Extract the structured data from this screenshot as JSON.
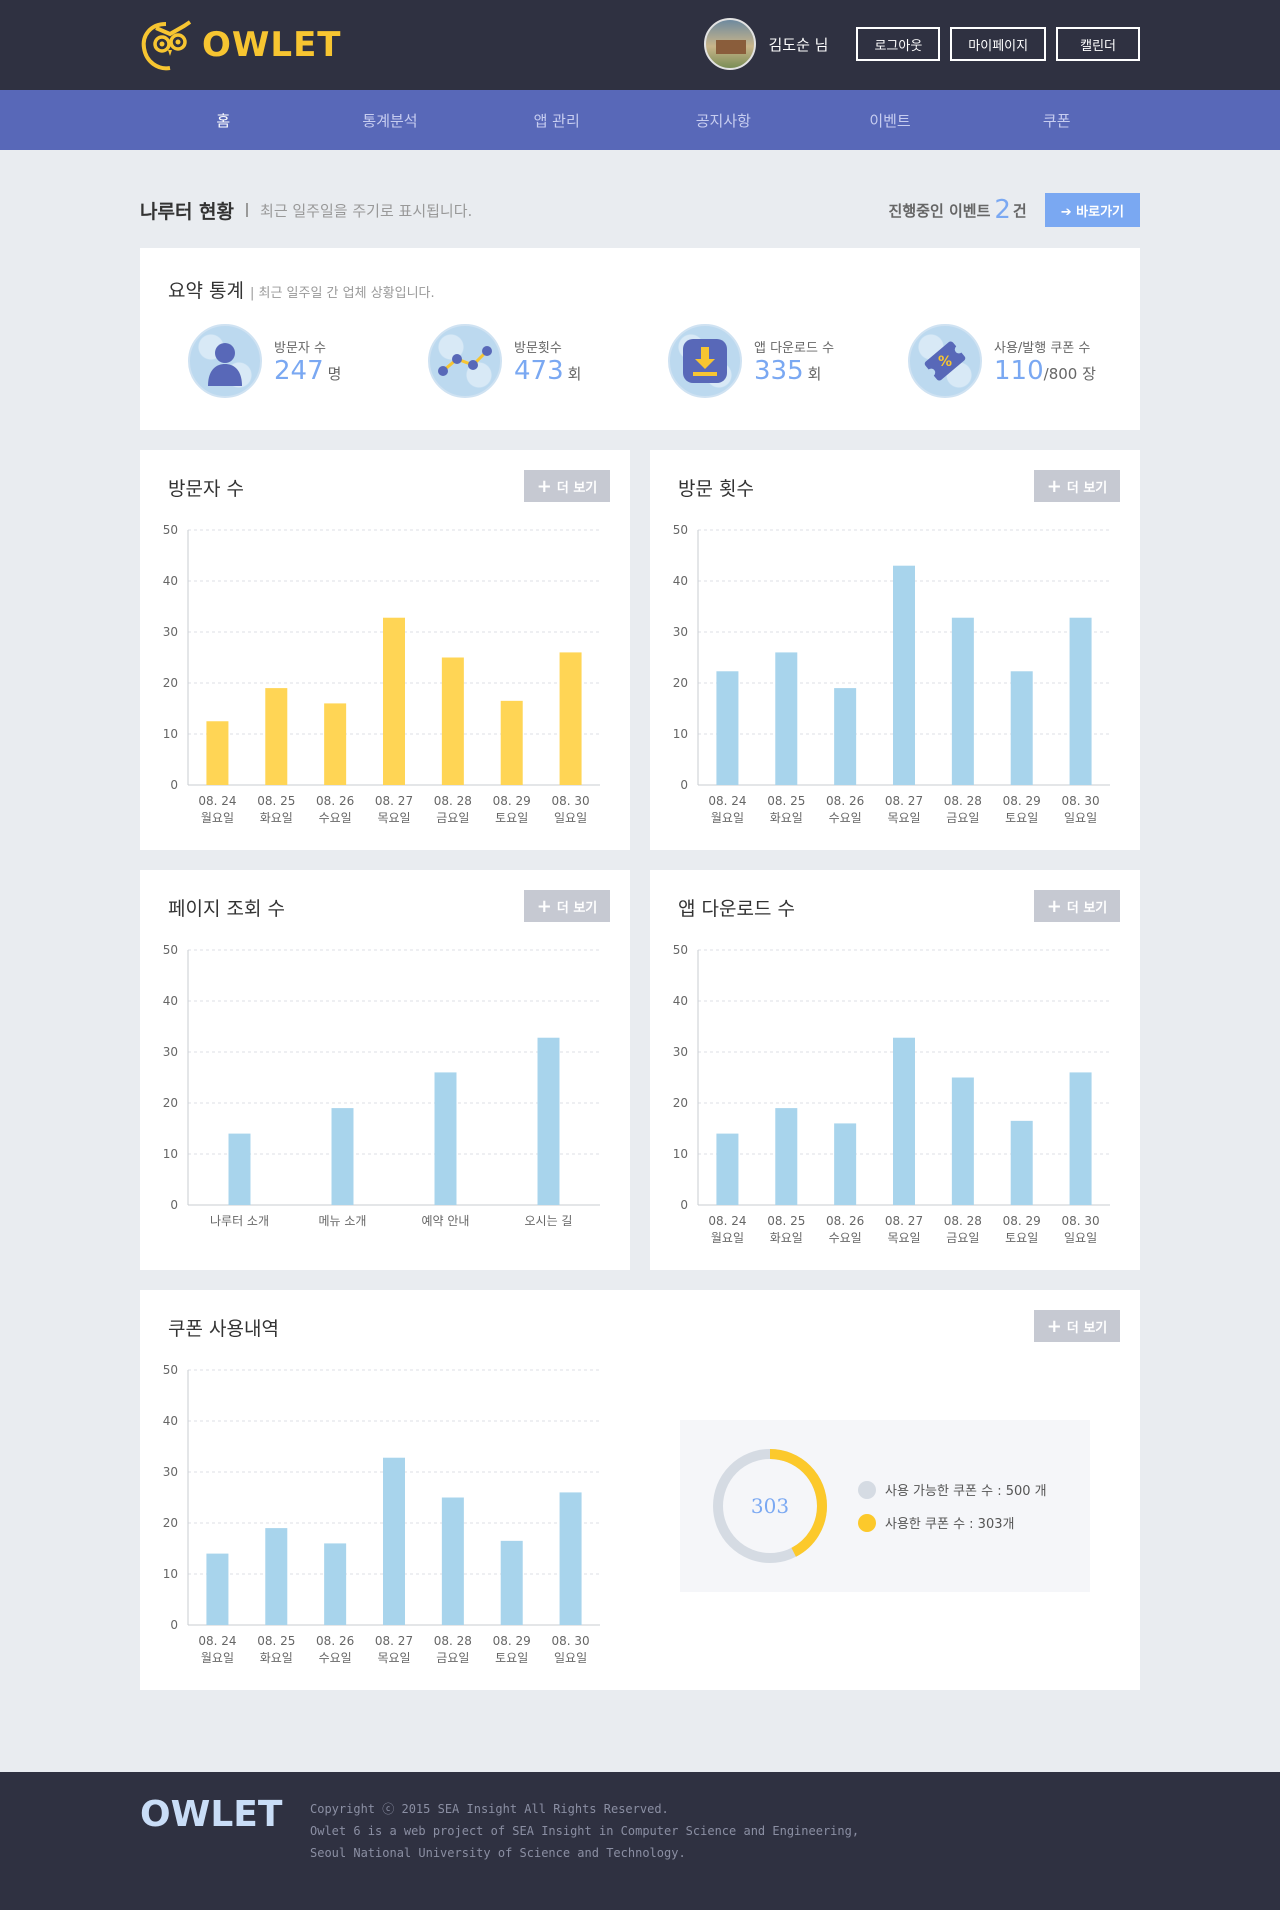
{
  "app": {
    "logo": "OWLET"
  },
  "user": {
    "name": "김도순 님",
    "buttons": [
      "로그아웃",
      "마이페이지",
      "캘린더"
    ]
  },
  "nav": [
    "홈",
    "통계분석",
    "앱 관리",
    "공지사항",
    "이벤트",
    "쿠폰"
  ],
  "status": {
    "title": "나루터 현황",
    "subtitle": "최근 일주일을 주기로 표시됩니다.",
    "event_prefix": "진행중인 이벤트",
    "event_count": "2",
    "event_suffix": "건",
    "go_label": "바로가기"
  },
  "summary": {
    "title": "요약 통계",
    "subtitle": "| 최근 일주일 간 업체 상황입니다.",
    "stats": [
      {
        "label": "방문자 수",
        "value": "247",
        "unit": "명",
        "icon": "person-icon"
      },
      {
        "label": "방문횟수",
        "value": "473",
        "unit": "회",
        "icon": "trend-icon"
      },
      {
        "label": "앱 다운로드 수",
        "value": "335",
        "unit": "회",
        "icon": "download-icon"
      },
      {
        "label": "사용/발행 쿠폰 수",
        "value": "110",
        "unit": "/800 장",
        "icon": "coupon-icon"
      }
    ]
  },
  "more_label": "더 보기",
  "colors": {
    "yellow": "#ffd555",
    "blue": "#a8d4ec",
    "accent": "#7aa8f2"
  },
  "chart_data": [
    {
      "type": "bar",
      "title": "방문자 수",
      "categories": [
        "08. 24|월요일",
        "08. 25|화요일",
        "08. 26|수요일",
        "08. 27|목요일",
        "08. 28|금요일",
        "08. 29|토요일",
        "08. 30|일요일"
      ],
      "values": [
        12.5,
        19,
        16,
        32.8,
        25,
        16.5,
        26
      ],
      "ylim": [
        0,
        50
      ],
      "yticks": [
        0,
        10,
        20,
        30,
        40,
        50
      ],
      "grid": true,
      "color": "#ffd555"
    },
    {
      "type": "bar",
      "title": "방문 횟수",
      "categories": [
        "08. 24|월요일",
        "08. 25|화요일",
        "08. 26|수요일",
        "08. 27|목요일",
        "08. 28|금요일",
        "08. 29|토요일",
        "08. 30|일요일"
      ],
      "values": [
        22.3,
        26,
        19,
        43,
        32.8,
        22.3,
        32.8
      ],
      "ylim": [
        0,
        50
      ],
      "yticks": [
        0,
        10,
        20,
        30,
        40,
        50
      ],
      "grid": true,
      "color": "#a8d4ec"
    },
    {
      "type": "bar",
      "title": "페이지 조회 수",
      "categories": [
        "나루터 소개",
        "메뉴 소개",
        "예약 안내",
        "오시는 길"
      ],
      "values": [
        14,
        19,
        26,
        32.8
      ],
      "ylim": [
        0,
        50
      ],
      "yticks": [
        0,
        10,
        20,
        30,
        40,
        50
      ],
      "grid": true,
      "color": "#a8d4ec"
    },
    {
      "type": "bar",
      "title": "앱 다운로드 수",
      "categories": [
        "08. 24|월요일",
        "08. 25|화요일",
        "08. 26|수요일",
        "08. 27|목요일",
        "08. 28|금요일",
        "08. 29|토요일",
        "08. 30|일요일"
      ],
      "values": [
        14,
        19,
        16,
        32.8,
        25,
        16.5,
        26
      ],
      "ylim": [
        0,
        50
      ],
      "yticks": [
        0,
        10,
        20,
        30,
        40,
        50
      ],
      "grid": true,
      "color": "#a8d4ec"
    },
    {
      "type": "bar",
      "title": "쿠폰 사용내역",
      "categories": [
        "08. 24|월요일",
        "08. 25|화요일",
        "08. 26|수요일",
        "08. 27|목요일",
        "08. 28|금요일",
        "08. 29|토요일",
        "08. 30|일요일"
      ],
      "values": [
        14,
        19,
        16,
        32.8,
        25,
        16.5,
        26
      ],
      "ylim": [
        0,
        50
      ],
      "yticks": [
        0,
        10,
        20,
        30,
        40,
        50
      ],
      "grid": true,
      "color": "#a8d4ec"
    }
  ],
  "coupon_donut": {
    "center": "303",
    "used": 303,
    "total": 500,
    "legend": [
      "사용 가능한 쿠폰 수 : 500 개",
      "사용한 쿠폰 수 : 303개"
    ],
    "colors": [
      "#d5dbe3",
      "#fcc92b"
    ]
  },
  "footer": {
    "logo": "OWLET",
    "lines": [
      "Copyright ⓒ 2015 SEA Insight All Rights Reserved.",
      "Owlet 6 is a web project of SEA Insight in Computer Science and Engineering,",
      "Seoul National University of Science and Technology."
    ]
  }
}
